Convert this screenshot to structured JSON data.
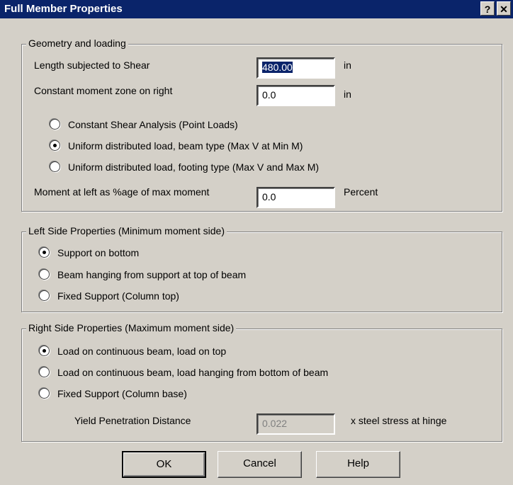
{
  "window": {
    "title": "Full Member Properties",
    "help_glyph": "?",
    "close_glyph": "✕"
  },
  "geometry": {
    "group_title": "Geometry and loading",
    "length_label": "Length subjected to Shear",
    "length_value": "480.00",
    "length_unit": "in",
    "cmz_label": "Constant moment zone on right",
    "cmz_value": "0.0",
    "cmz_unit": "in",
    "options": [
      {
        "label": "Constant Shear Analysis (Point Loads)",
        "checked": false
      },
      {
        "label": "Uniform distributed load, beam type (Max V at Min M)",
        "checked": true
      },
      {
        "label": "Uniform distributed load, footing type (Max V and Max M)",
        "checked": false
      }
    ],
    "moment_label": "Moment at left as %age of max moment",
    "moment_value": "0.0",
    "moment_unit": "Percent"
  },
  "left_side": {
    "group_title": "Left Side Properties (Minimum moment side)",
    "options": [
      {
        "label": "Support on bottom",
        "checked": true
      },
      {
        "label": "Beam hanging from support at top of beam",
        "checked": false
      },
      {
        "label": "Fixed Support (Column top)",
        "checked": false
      }
    ]
  },
  "right_side": {
    "group_title": "Right Side Properties (Maximum moment side)",
    "options": [
      {
        "label": "Load on continuous beam, load on top",
        "checked": true
      },
      {
        "label": "Load on continuous beam, load hanging from bottom of beam",
        "checked": false
      },
      {
        "label": "Fixed Support (Column base)",
        "checked": false
      }
    ],
    "yield_label": "Yield Penetration Distance",
    "yield_value": "0.022",
    "yield_unit": "x steel stress at hinge"
  },
  "buttons": {
    "ok": "OK",
    "cancel": "Cancel",
    "help": "Help"
  }
}
